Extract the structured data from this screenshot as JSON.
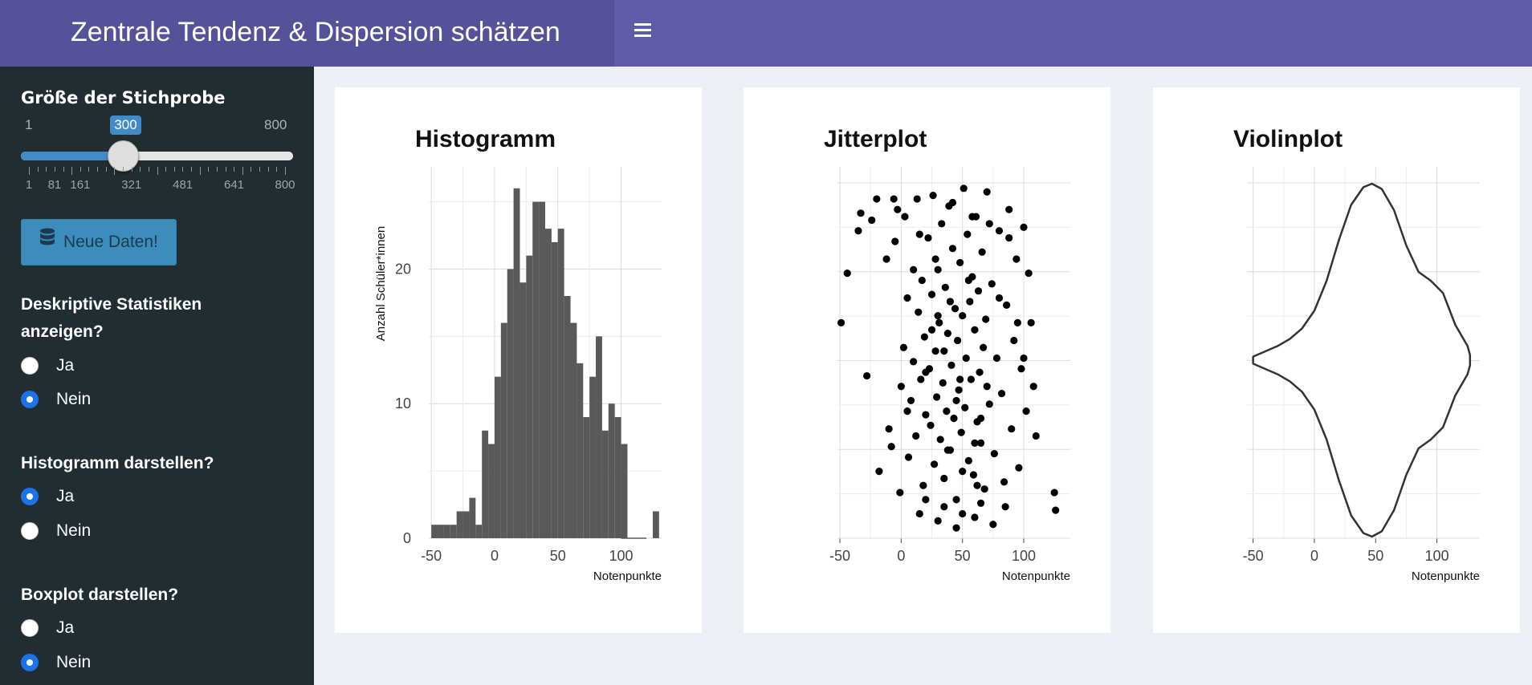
{
  "header": {
    "title": "Zentrale Tendenz & Dispersion schätzen"
  },
  "sidebar": {
    "sample_size": {
      "label": "Größe der Stichprobe",
      "min": "1",
      "max": "800",
      "value": "300",
      "fraction": 0.374,
      "ticks": [
        "1",
        "81",
        "161",
        "321",
        "481",
        "641",
        "800"
      ]
    },
    "new_data_button": "Neue Daten!",
    "descriptive": {
      "label1": "Deskriptive Statistiken",
      "label2": "anzeigen?",
      "yes": "Ja",
      "no": "Nein",
      "selected": "Nein"
    },
    "histogram": {
      "label": "Histogramm darstellen?",
      "yes": "Ja",
      "no": "Nein",
      "selected": "Ja"
    },
    "boxplot": {
      "label": "Boxplot darstellen?",
      "yes": "Ja",
      "no": "Nein",
      "selected": "Nein"
    }
  },
  "colors": {
    "header": "#605ca8",
    "logo": "#555299",
    "sidebar": "#222d32",
    "accent": "#3c8dbc",
    "radio": "#1a73e8",
    "bars": "#595959"
  },
  "chart_data": [
    {
      "type": "bar",
      "title": "Histogramm",
      "xlabel": "Notenpunkte",
      "ylabel": "Anzahl Schüler*innen",
      "xlim": [
        -52,
        132
      ],
      "ylim": [
        0,
        27
      ],
      "xticks": [
        -50,
        0,
        50,
        100
      ],
      "yticks": [
        0,
        10,
        20
      ],
      "bin_width": 5,
      "bin_starts": [
        -50,
        -45,
        -40,
        -35,
        -30,
        -25,
        -20,
        -15,
        -10,
        -5,
        0,
        5,
        10,
        15,
        20,
        25,
        30,
        35,
        40,
        45,
        50,
        55,
        60,
        65,
        70,
        75,
        80,
        85,
        90,
        95,
        100,
        105,
        110,
        115,
        120,
        125
      ],
      "counts": [
        1,
        1,
        1,
        1,
        2,
        2,
        3,
        1,
        8,
        7,
        12,
        16,
        20,
        26,
        19,
        21,
        25,
        25,
        23,
        22,
        23,
        18,
        16,
        13,
        9,
        12,
        15,
        8,
        10,
        9,
        7,
        0,
        0,
        0,
        0,
        2
      ]
    },
    {
      "type": "scatter",
      "title": "Jitterplot",
      "xlabel": "Notenpunkte",
      "xlim": [
        -52,
        138
      ],
      "xticks": [
        -50,
        0,
        50,
        100
      ],
      "points": [
        [
          -49,
          0.6
        ],
        [
          -44,
          0.74
        ],
        [
          -35,
          0.86
        ],
        [
          -33,
          0.91
        ],
        [
          -28,
          0.45
        ],
        [
          -24,
          0.89
        ],
        [
          -18,
          0.18
        ],
        [
          -12,
          0.78
        ],
        [
          -10,
          0.3
        ],
        [
          -8,
          0.25
        ],
        [
          -6,
          0.95
        ],
        [
          -5,
          0.83
        ],
        [
          -3,
          0.92
        ],
        [
          -1,
          0.12
        ],
        [
          0,
          0.42
        ],
        [
          2,
          0.53
        ],
        [
          3,
          0.9
        ],
        [
          5,
          0.67
        ],
        [
          6,
          0.22
        ],
        [
          8,
          0.38
        ],
        [
          10,
          0.49
        ],
        [
          12,
          0.28
        ],
        [
          13,
          0.95
        ],
        [
          14,
          0.63
        ],
        [
          16,
          0.44
        ],
        [
          17,
          0.72
        ],
        [
          18,
          0.14
        ],
        [
          19,
          0.56
        ],
        [
          20,
          0.34
        ],
        [
          22,
          0.84
        ],
        [
          23,
          0.47
        ],
        [
          24,
          0.31
        ],
        [
          25,
          0.68
        ],
        [
          26,
          0.96
        ],
        [
          27,
          0.2
        ],
        [
          28,
          0.52
        ],
        [
          29,
          0.39
        ],
        [
          30,
          0.75
        ],
        [
          31,
          0.6
        ],
        [
          32,
          0.27
        ],
        [
          33,
          0.88
        ],
        [
          34,
          0.43
        ],
        [
          35,
          0.16
        ],
        [
          36,
          0.7
        ],
        [
          37,
          0.35
        ],
        [
          38,
          0.57
        ],
        [
          39,
          0.93
        ],
        [
          40,
          0.24
        ],
        [
          41,
          0.48
        ],
        [
          42,
          0.81
        ],
        [
          43,
          0.33
        ],
        [
          44,
          0.64
        ],
        [
          45,
          0.1
        ],
        [
          46,
          0.55
        ],
        [
          47,
          0.41
        ],
        [
          48,
          0.77
        ],
        [
          49,
          0.29
        ],
        [
          50,
          0.62
        ],
        [
          51,
          0.98
        ],
        [
          52,
          0.36
        ],
        [
          53,
          0.5
        ],
        [
          54,
          0.85
        ],
        [
          55,
          0.21
        ],
        [
          56,
          0.66
        ],
        [
          57,
          0.44
        ],
        [
          58,
          0.73
        ],
        [
          59,
          0.17
        ],
        [
          60,
          0.58
        ],
        [
          61,
          0.9
        ],
        [
          62,
          0.32
        ],
        [
          63,
          0.69
        ],
        [
          64,
          0.46
        ],
        [
          65,
          0.26
        ],
        [
          66,
          0.8
        ],
        [
          67,
          0.53
        ],
        [
          68,
          0.13
        ],
        [
          69,
          0.61
        ],
        [
          70,
          0.97
        ],
        [
          72,
          0.37
        ],
        [
          74,
          0.71
        ],
        [
          76,
          0.23
        ],
        [
          78,
          0.5
        ],
        [
          80,
          0.86
        ],
        [
          82,
          0.4
        ],
        [
          84,
          0.15
        ],
        [
          86,
          0.65
        ],
        [
          88,
          0.92
        ],
        [
          90,
          0.3
        ],
        [
          92,
          0.55
        ],
        [
          94,
          0.78
        ],
        [
          96,
          0.19
        ],
        [
          98,
          0.47
        ],
        [
          100,
          0.87
        ],
        [
          102,
          0.35
        ],
        [
          104,
          0.74
        ],
        [
          106,
          0.6
        ],
        [
          108,
          0.42
        ],
        [
          110,
          0.28
        ],
        [
          125,
          0.12
        ],
        [
          126,
          0.07
        ],
        [
          -20,
          0.95
        ],
        [
          15,
          0.06
        ],
        [
          30,
          0.04
        ],
        [
          45,
          0.02
        ],
        [
          60,
          0.05
        ],
        [
          75,
          0.03
        ],
        [
          85,
          0.08
        ],
        [
          20,
          0.1
        ],
        [
          35,
          0.08
        ],
        [
          50,
          0.06
        ],
        [
          65,
          0.09
        ],
        [
          40,
          0.66
        ],
        [
          55,
          0.72
        ],
        [
          25,
          0.58
        ],
        [
          70,
          0.42
        ],
        [
          35,
          0.52
        ],
        [
          45,
          0.38
        ],
        [
          60,
          0.26
        ],
        [
          20,
          0.46
        ],
        [
          30,
          0.62
        ],
        [
          50,
          0.18
        ],
        [
          65,
          0.33
        ],
        [
          80,
          0.67
        ],
        [
          10,
          0.75
        ],
        [
          5,
          0.35
        ],
        [
          95,
          0.6
        ],
        [
          100,
          0.5
        ],
        [
          15,
          0.85
        ],
        [
          28,
          0.78
        ],
        [
          42,
          0.94
        ],
        [
          58,
          0.9
        ],
        [
          72,
          0.88
        ],
        [
          88,
          0.84
        ],
        [
          48,
          0.44
        ],
        [
          38,
          0.24
        ],
        [
          62,
          0.14
        ]
      ]
    },
    {
      "type": "area",
      "title": "Violinplot",
      "xlabel": "Notenpunkte",
      "xlim": [
        -55,
        135
      ],
      "xticks": [
        -50,
        0,
        50,
        100
      ],
      "x": [
        -50,
        -40,
        -30,
        -20,
        -10,
        0,
        10,
        20,
        30,
        40,
        47,
        55,
        65,
        75,
        85,
        95,
        105,
        115,
        125,
        127
      ],
      "half_width": [
        0.02,
        0.05,
        0.08,
        0.12,
        0.18,
        0.28,
        0.45,
        0.68,
        0.88,
        0.98,
        1.0,
        0.97,
        0.85,
        0.65,
        0.5,
        0.45,
        0.38,
        0.2,
        0.08,
        0.03
      ]
    }
  ]
}
